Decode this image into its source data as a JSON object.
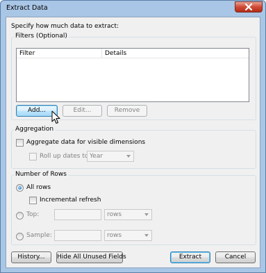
{
  "window": {
    "title": "Extract Data"
  },
  "intro": "Specify how much data to extract:",
  "filters": {
    "title": "Filters (Optional)",
    "columns": [
      "Filter",
      "Details"
    ],
    "rows": [],
    "add_label": "Add...",
    "edit_label": "Edit...",
    "remove_label": "Remove"
  },
  "aggregation": {
    "title": "Aggregation",
    "aggregate_label": "Aggregate data for visible dimensions",
    "aggregate_checked": false,
    "rollup_label": "Roll up dates to",
    "rollup_checked": false,
    "rollup_value": "Year"
  },
  "rows_section": {
    "title": "Number of Rows",
    "all_rows_label": "All rows",
    "all_rows_selected": true,
    "incremental_label": "Incremental refresh",
    "incremental_checked": false,
    "top_label": "Top:",
    "top_value": "",
    "top_unit": "rows",
    "sample_label": "Sample:",
    "sample_value": "",
    "sample_unit": "rows"
  },
  "footer": {
    "history_label": "History...",
    "hide_unused_label": "Hide All Unused Fields",
    "extract_label": "Extract",
    "cancel_label": "Cancel"
  },
  "colors": {
    "frame": "#aac6e6",
    "dialog_bg": "#f0f0f0",
    "close": "#c8452f",
    "focus": "#3c7fb1"
  }
}
